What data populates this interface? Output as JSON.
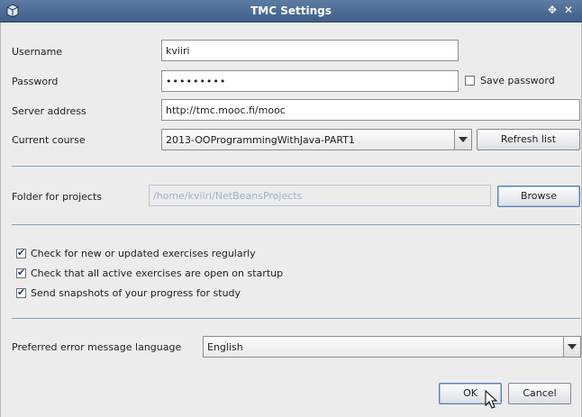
{
  "window": {
    "title": "TMC Settings",
    "maximize_glyph": "✥",
    "close_glyph": "✕"
  },
  "form": {
    "username_label": "Username",
    "username_value": "kviiri",
    "password_label": "Password",
    "password_value": "•••••••••",
    "save_password_label": "Save password",
    "save_password_checked": false,
    "server_label": "Server address",
    "server_value": "http://tmc.mooc.fi/mooc",
    "course_label": "Current course",
    "course_value": "2013-OOProgrammingWithJava-PART1",
    "refresh_label": "Refresh list",
    "folder_label": "Folder for projects",
    "folder_value": "/home/kviiri/NetBeansProjects",
    "browse_label": "Browse"
  },
  "options": {
    "check_updates_label": "Check for new or updated exercises regularly",
    "check_updates_checked": true,
    "check_open_label": "Check that all active exercises are open on startup",
    "check_open_checked": true,
    "send_snapshots_label": "Send snapshots of your progress for study",
    "send_snapshots_checked": true
  },
  "language": {
    "label": "Preferred error message language",
    "value": "English"
  },
  "dialog_buttons": {
    "ok_label": "OK",
    "cancel_label": "Cancel"
  },
  "icons": {
    "app": "netbeans-cube-icon",
    "maximize": "maximize-icon",
    "close": "close-icon",
    "check": "✔",
    "cursor": "mouse-pointer-icon"
  }
}
